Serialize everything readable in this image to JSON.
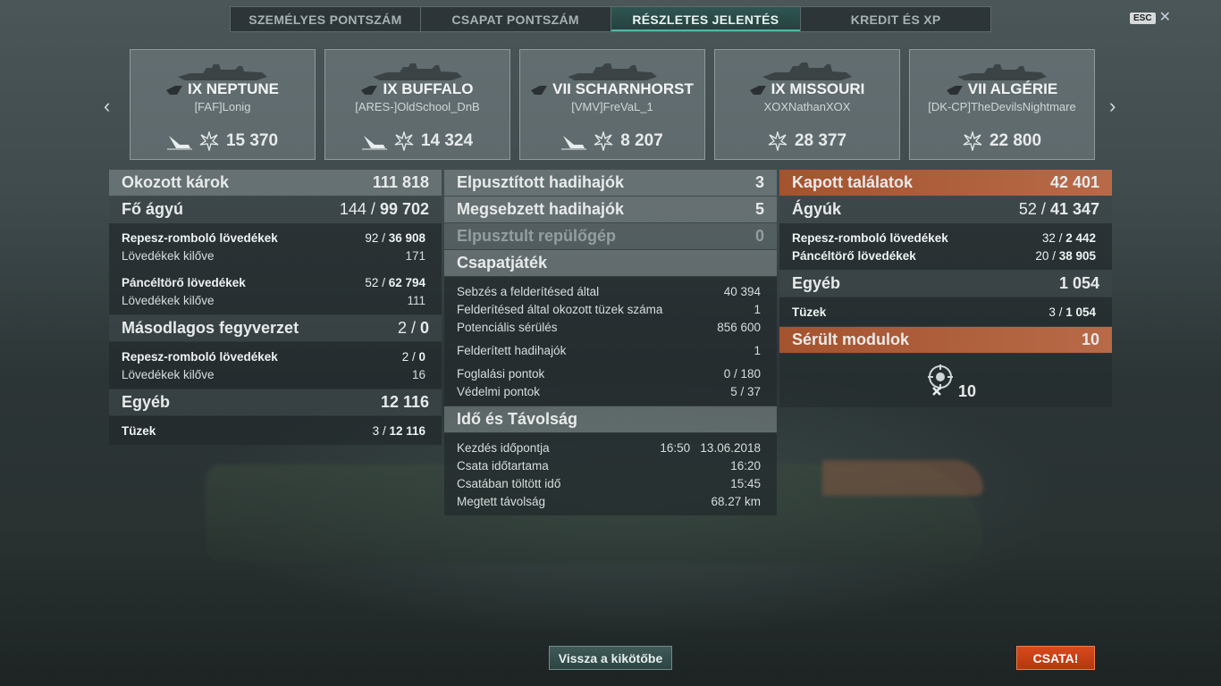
{
  "tabs": [
    {
      "label": "SZEMÉLYES PONTSZÁM"
    },
    {
      "label": "CSAPAT PONTSZÁM"
    },
    {
      "label": "RÉSZLETES JELENTÉS"
    },
    {
      "label": "KREDIT ÉS XP"
    }
  ],
  "esc": {
    "label": "ESC",
    "close": "✕"
  },
  "ships": [
    {
      "name": "IX NEPTUNE",
      "player": "[FAF]Lonig",
      "damage": "15 370"
    },
    {
      "name": "IX BUFFALO",
      "player": "[ARES-]OldSchool_DnB",
      "damage": "14 324"
    },
    {
      "name": "VII SCHARNHORST",
      "player": "[VMV]FreVaL_1",
      "damage": "8 207"
    },
    {
      "name": "IX MISSOURI",
      "player": "XOXNathanXOX",
      "damage": "28 377"
    },
    {
      "name": "VII ALGÉRIE",
      "player": "[DK-CP]TheDevilsNightmare",
      "damage": "22 800"
    }
  ],
  "left": {
    "dealt": {
      "label": "Okozott károk",
      "value": "111 818"
    },
    "main": {
      "label": "Fő ágyú",
      "hits": "144",
      "dmg": "99 702"
    },
    "he": {
      "label": "Repesz-romboló lövedékek",
      "hits": "92",
      "dmg": "36 908"
    },
    "he_fired": {
      "label": "Lövedékek kilőve",
      "value": "171"
    },
    "ap": {
      "label": "Páncéltörő lövedékek",
      "hits": "52",
      "dmg": "62 794"
    },
    "ap_fired": {
      "label": "Lövedékek kilőve",
      "value": "111"
    },
    "secondary": {
      "label": "Másodlagos fegyverzet",
      "hits": "2",
      "dmg": "0"
    },
    "sec_he": {
      "label": "Repesz-romboló lövedékek",
      "hits": "2",
      "dmg": "0"
    },
    "sec_fired": {
      "label": "Lövedékek kilőve",
      "value": "16"
    },
    "other": {
      "label": "Egyéb",
      "value": "12 116"
    },
    "fires": {
      "label": "Tüzek",
      "hits": "3",
      "dmg": "12 116"
    }
  },
  "mid": {
    "destroyed": {
      "label": "Elpusztított hadihajók",
      "value": "3"
    },
    "damaged": {
      "label": "Megsebzett hadihajók",
      "value": "5"
    },
    "planes": {
      "label": "Elpusztult repülőgép",
      "value": "0"
    },
    "team": {
      "label": "Csapatjáték"
    },
    "spot_dmg": {
      "label": "Sebzés a felderítésed által",
      "value": "40 394"
    },
    "spot_fires": {
      "label": "Felderítésed által okozott tüzek száma",
      "value": "1"
    },
    "potential": {
      "label": "Potenciális sérülés",
      "value": "856 600"
    },
    "spotted": {
      "label": "Felderített hadihajók",
      "value": "1"
    },
    "capture": {
      "label": "Foglalási pontok",
      "value": "0 / 180"
    },
    "defense": {
      "label": "Védelmi pontok",
      "value": "5 / 37"
    },
    "time": {
      "label": "Idő és Távolság"
    },
    "start": {
      "label": "Kezdés időpontja",
      "value": "16:50   13.06.2018"
    },
    "duration": {
      "label": "Csata időtartama",
      "value": "16:20"
    },
    "in_battle": {
      "label": "Csatában töltött idő",
      "value": "15:45"
    },
    "distance": {
      "label": "Megtett távolság",
      "value": "68.27 km"
    }
  },
  "right": {
    "received": {
      "label": "Kapott találatok",
      "value": "42 401"
    },
    "guns": {
      "label": "Ágyúk",
      "hits": "52",
      "dmg": "41 347"
    },
    "he": {
      "label": "Repesz-romboló lövedékek",
      "hits": "32",
      "dmg": "2 442"
    },
    "ap": {
      "label": "Páncéltörő lövedékek",
      "hits": "20",
      "dmg": "38 905"
    },
    "other": {
      "label": "Egyéb",
      "value": "1 054"
    },
    "fires": {
      "label": "Tüzek",
      "hits": "3",
      "dmg": "1 054"
    },
    "modules": {
      "label": "Sérült modulok",
      "value": "10",
      "count": "10"
    }
  },
  "buttons": {
    "back": "Vissza a kikötőbe",
    "battle": "CSATA!"
  },
  "colors": {
    "accent": "#4fb6a8",
    "battle": "#d84a1c",
    "received": "#a4532e"
  }
}
